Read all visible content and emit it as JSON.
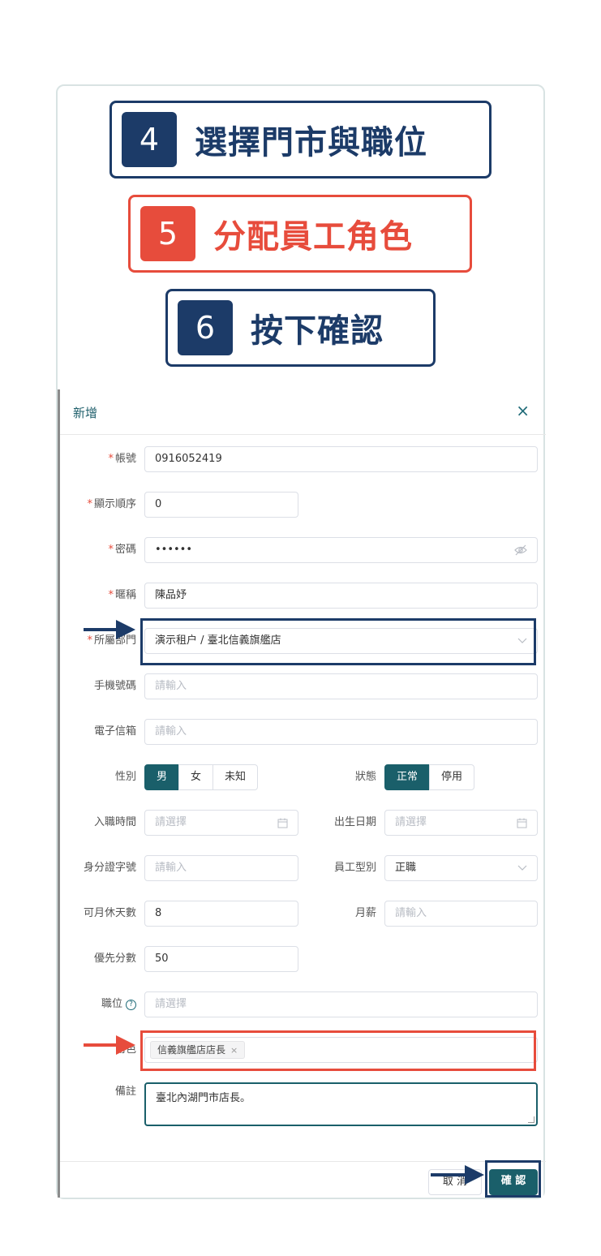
{
  "steps": [
    {
      "num": "4",
      "text": "選擇門市與職位",
      "color": "#1c3b68"
    },
    {
      "num": "5",
      "text": "分配員工角色",
      "color": "#e74c3c"
    },
    {
      "num": "6",
      "text": "按下確認",
      "color": "#1c3b68"
    }
  ],
  "dialog": {
    "title": "新增",
    "close_icon": "×",
    "fields": {
      "account": {
        "label": "帳號",
        "value": "0916052419"
      },
      "display_order": {
        "label": "顯示順序",
        "value": "0"
      },
      "password": {
        "label": "密碼",
        "value": "••••••",
        "icon": "eye-off-icon"
      },
      "nickname": {
        "label": "暱稱",
        "value": "陳品妤"
      },
      "department": {
        "label": "所屬部門",
        "value": "演示租户 / 臺北信義旗艦店",
        "icon": "chevron-down-icon"
      },
      "mobile": {
        "label": "手機號碼",
        "placeholder": "請輸入"
      },
      "email": {
        "label": "電子信箱",
        "placeholder": "請輸入"
      },
      "gender": {
        "label": "性別",
        "options": [
          "男",
          "女",
          "未知"
        ],
        "selected": "男"
      },
      "status": {
        "label": "狀態",
        "options": [
          "正常",
          "停用"
        ],
        "selected": "正常"
      },
      "hire_date": {
        "label": "入職時間",
        "placeholder": "請選擇",
        "icon": "calendar-icon"
      },
      "birth_date": {
        "label": "出生日期",
        "placeholder": "請選擇",
        "icon": "calendar-icon"
      },
      "id_number": {
        "label": "身分證字號",
        "placeholder": "請輸入"
      },
      "employee_type": {
        "label": "員工型別",
        "value": "正職",
        "icon": "chevron-down-icon"
      },
      "monthly_off_days": {
        "label": "可月休天數",
        "value": "8"
      },
      "monthly_salary": {
        "label": "月薪",
        "placeholder": "請輸入"
      },
      "priority_score": {
        "label": "優先分數",
        "value": "50"
      },
      "position": {
        "label": "職位",
        "placeholder": "請選擇",
        "help_icon": "?"
      },
      "role": {
        "label": "角色",
        "tag": "信義旗艦店店長",
        "tag_close": "×"
      },
      "remark": {
        "label": "備註",
        "value": "臺北內湖門市店長。"
      }
    },
    "buttons": {
      "cancel": "取 消",
      "confirm": "確 認"
    }
  },
  "colors": {
    "navy": "#1c3b68",
    "red": "#e74c3c",
    "primary": "#1a5f6a",
    "required": "#e74c3c"
  }
}
